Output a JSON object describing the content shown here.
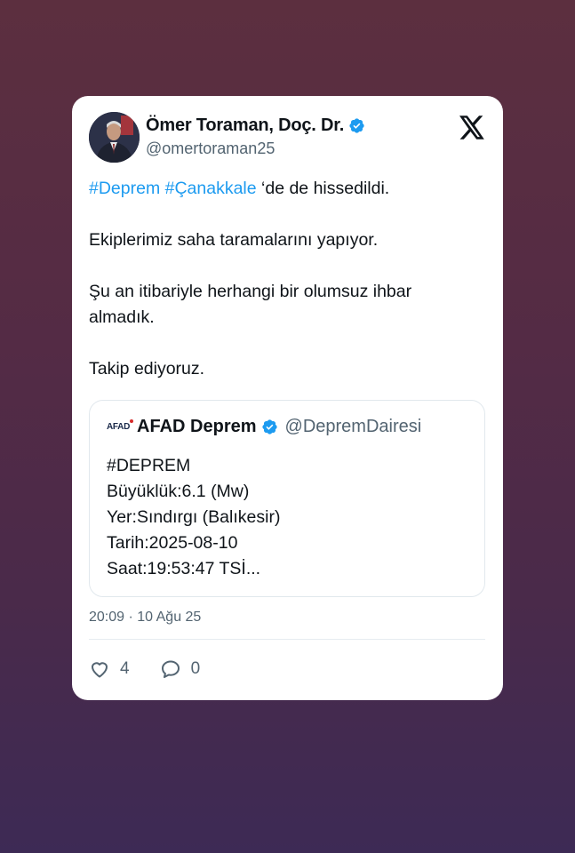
{
  "tweet": {
    "author_name": "Ömer Toraman, Doç. Dr.",
    "author_handle": "@omertoraman25",
    "hashtag_1": "#Deprem",
    "hashtag_2": "#Çanakkale",
    "line_1_rest": " ‘de de hissedildi.",
    "paragraph_2": "Ekiplerimiz saha taramalarını yapıyor.",
    "paragraph_3_line_1": "Şu an itibariyle herhangi bir olumsuz ihbar",
    "paragraph_3_line_2": "almadık.",
    "paragraph_4": "Takip ediyoruz.",
    "timestamp": "20:09 · 10 Ağu 25",
    "likes": "4",
    "replies": "0"
  },
  "quote": {
    "logo_text": "AFAD",
    "author_name": "AFAD Deprem",
    "author_handle": "@DepremDairesi",
    "lines": [
      "#DEPREM",
      "Büyüklük:6.1 (Mw)",
      "Yer:Sındırgı (Balıkesir)",
      "Tarih:2025-08-10",
      "Saat:19:53:47 TSİ..."
    ]
  },
  "colors": {
    "accent": "#1d9bf0",
    "text": "#0f1419",
    "muted": "#536471",
    "card_bg": "#ffffff"
  },
  "icons": {
    "brand": "x-logo-icon",
    "verified": "verified-badge-icon",
    "like": "heart-icon",
    "reply": "reply-bubble-icon"
  }
}
